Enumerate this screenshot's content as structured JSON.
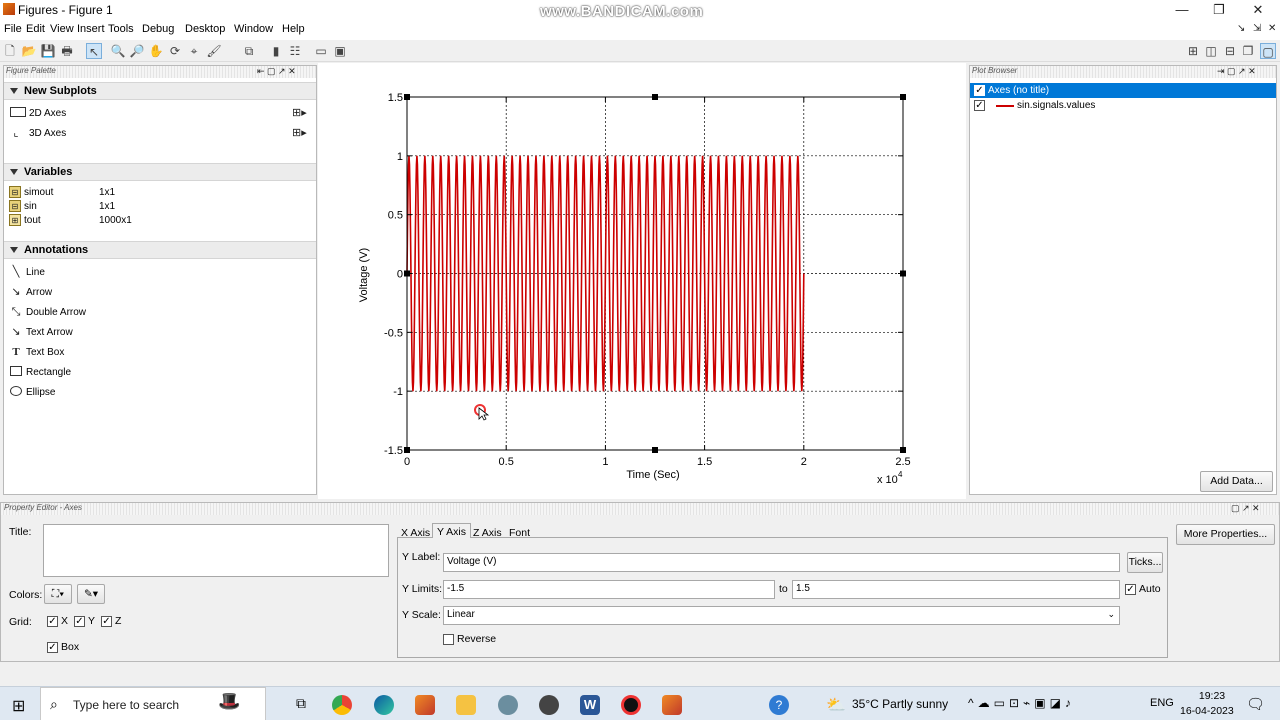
{
  "window": {
    "title": "Figures - Figure 1",
    "watermark": "www.BANDICAM.com",
    "controls": [
      "—",
      "❐",
      "✕"
    ]
  },
  "menu": {
    "items": [
      "File",
      "Edit",
      "View",
      "Insert",
      "Tools",
      "Debug",
      "Desktop",
      "Window",
      "Help"
    ],
    "right_controls": [
      "↘",
      "⇲",
      "✕"
    ]
  },
  "figure_palette": {
    "header": "Figure Palette",
    "new_subplots": {
      "title": "New Subplots",
      "items": [
        "2D Axes",
        "3D Axes"
      ]
    },
    "variables": {
      "title": "Variables",
      "items": [
        {
          "name": "simout",
          "size": "1x1"
        },
        {
          "name": "sin",
          "size": "1x1"
        },
        {
          "name": "tout",
          "size": "1000x1"
        }
      ]
    },
    "annotations": {
      "title": "Annotations",
      "items": [
        "Line",
        "Arrow",
        "Double Arrow",
        "Text Arrow",
        "Text Box",
        "Rectangle",
        "Ellipse"
      ]
    }
  },
  "plot_browser": {
    "header": "Plot Browser",
    "axes_label": "Axes (no title)",
    "series_label": "sin.signals.values",
    "add_data": "Add Data..."
  },
  "chart_data": {
    "type": "line",
    "title": "",
    "xlabel": "Time (Sec)",
    "ylabel": "Voltage (V)",
    "x_exponent_label": "x 10",
    "x_exponent_power": "4",
    "xlim": [
      0,
      2.5
    ],
    "ylim": [
      -1.5,
      1.5
    ],
    "xticks": [
      "0",
      "0.5",
      "1",
      "1.5",
      "2",
      "2.5"
    ],
    "yticks": [
      "1.5",
      "1",
      "0.5",
      "0",
      "-0.5",
      "-1",
      "-1.5"
    ],
    "grid": true,
    "series": [
      {
        "name": "sin.signals.values",
        "color": "#cc0000",
        "x_range": [
          0,
          2
        ],
        "amplitude": 1,
        "cycles": 50
      }
    ]
  },
  "property_editor": {
    "header": "Property Editor - Axes",
    "title_label": "Title:",
    "title_value": "",
    "colors_label": "Colors:",
    "grid_label": "Grid:",
    "grid_x": "X",
    "grid_y": "Y",
    "grid_z": "Z",
    "box_label": "Box",
    "tabs": [
      "X Axis",
      "Y Axis",
      "Z Axis",
      "Font"
    ],
    "active_tab": "Y Axis",
    "y_label_label": "Y Label:",
    "y_label_value": "Voltage (V)",
    "ticks_button": "Ticks...",
    "y_limits_label": "Y Limits:",
    "y_limit_min": "-1.5",
    "to_label": "to",
    "y_limit_max": "1.5",
    "auto_label": "Auto",
    "y_scale_label": "Y Scale:",
    "y_scale_value": "Linear",
    "reverse_label": "Reverse",
    "more_properties": "More Properties..."
  },
  "taskbar": {
    "search_placeholder": "Type here to search",
    "weather": "35°C  Partly sunny",
    "language": "ENG",
    "time": "19:23",
    "date": "16-04-2023"
  },
  "colors": {
    "accent": "#0078d7",
    "series": "#cc0000"
  }
}
